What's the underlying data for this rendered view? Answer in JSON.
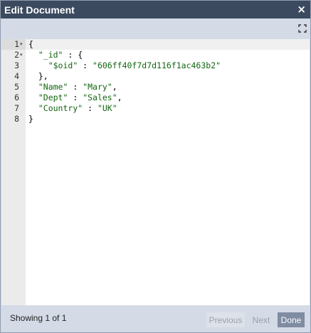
{
  "dialog": {
    "title": "Edit Document",
    "close_label": "×"
  },
  "editor": {
    "lines": [
      {
        "num": "1",
        "foldable": true,
        "indent": "",
        "parts": [
          [
            "p",
            "{"
          ]
        ]
      },
      {
        "num": "2",
        "foldable": true,
        "indent": "  ",
        "parts": [
          [
            "s",
            "\"_id\""
          ],
          [
            "p",
            " : {"
          ]
        ]
      },
      {
        "num": "3",
        "foldable": false,
        "indent": "    ",
        "parts": [
          [
            "s",
            "\"$oid\""
          ],
          [
            "p",
            " : "
          ],
          [
            "s",
            "\"606ff40f7d7d116f1ac463b2\""
          ]
        ]
      },
      {
        "num": "4",
        "foldable": false,
        "indent": "  ",
        "parts": [
          [
            "p",
            "},"
          ]
        ]
      },
      {
        "num": "5",
        "foldable": false,
        "indent": "  ",
        "parts": [
          [
            "s",
            "\"Name\""
          ],
          [
            "p",
            " : "
          ],
          [
            "s",
            "\"Mary\""
          ],
          [
            "p",
            ","
          ]
        ]
      },
      {
        "num": "6",
        "foldable": false,
        "indent": "  ",
        "parts": [
          [
            "s",
            "\"Dept\""
          ],
          [
            "p",
            " : "
          ],
          [
            "s",
            "\"Sales\""
          ],
          [
            "p",
            ","
          ]
        ]
      },
      {
        "num": "7",
        "foldable": false,
        "indent": "  ",
        "parts": [
          [
            "s",
            "\"Country\""
          ],
          [
            "p",
            " : "
          ],
          [
            "s",
            "\"UK\""
          ]
        ]
      },
      {
        "num": "8",
        "foldable": false,
        "indent": "",
        "parts": [
          [
            "p",
            "}"
          ]
        ]
      }
    ],
    "active_line": "1",
    "fold_glyph": "▾"
  },
  "footer": {
    "status": "Showing 1 of 1",
    "previous_label": "Previous",
    "next_label": "Next",
    "done_label": "Done"
  },
  "colors": {
    "titlebar": "#3b4a5f",
    "dialog_bg": "#d4dae6",
    "string": "#116611",
    "done_button": "#7f8ca2"
  },
  "icons": {
    "close": "close-icon",
    "expand": "expand-icon",
    "fold": "fold-arrow-icon"
  }
}
